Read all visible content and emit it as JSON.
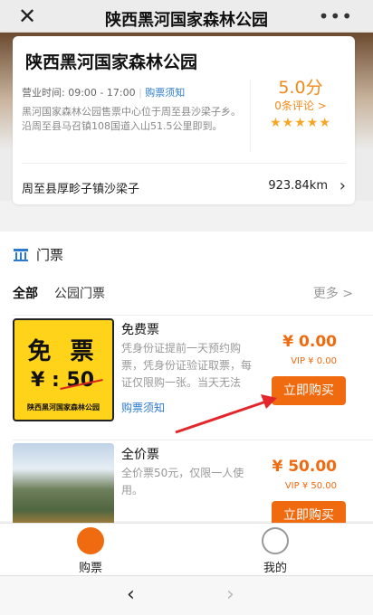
{
  "topbar": {
    "title": "陕西黑河国家森林公园",
    "close_icon": "close-icon",
    "more_icon": "more-dots-icon"
  },
  "park": {
    "name": "陕西黑河国家森林公园",
    "hours_label": "营业时间: 09:00 - 17:00",
    "notice_link": "购票须知",
    "description": "黑河国家森林公园售票中心位于周至县沙梁子乡。沿周至县马召镇108国道入山51.5公里即到。",
    "score": "5.0分",
    "reviews": "0条评论 >",
    "stars": 5,
    "address": "周至县厚畛子镇沙梁子",
    "distance": "923.84km"
  },
  "tickets": {
    "section_title": "门票",
    "section_icon": "ticket-house-icon",
    "tabs": [
      "全部",
      "公园门票"
    ],
    "more": "更多 >",
    "items": [
      {
        "name": "免费票",
        "desc": "凭身份证提前一天预约购票，凭身份证验证取票，每证仅限购一张。当天无法",
        "link": "购票须知",
        "price": "¥ 0.00",
        "vip": "VIP ¥ 0.00",
        "buy": "立即购买",
        "thumb_big": "免 票",
        "thumb_price": "¥ : 50",
        "thumb_small": "陕西黑河国家森林公园"
      },
      {
        "name": "全价票",
        "desc": "全价票50元，仅限一人使用。",
        "price": "¥ 50.00",
        "vip": "VIP ¥ 50.00",
        "buy": "立即购买"
      }
    ]
  },
  "nav": {
    "buy": "购票",
    "mine": "我的"
  },
  "browser": {
    "back": "‹",
    "forward": "›"
  },
  "colors": {
    "accent": "#f06a0f",
    "link": "#2a7ad2",
    "score": "#f18a1a",
    "arrow": "#e2262a"
  }
}
